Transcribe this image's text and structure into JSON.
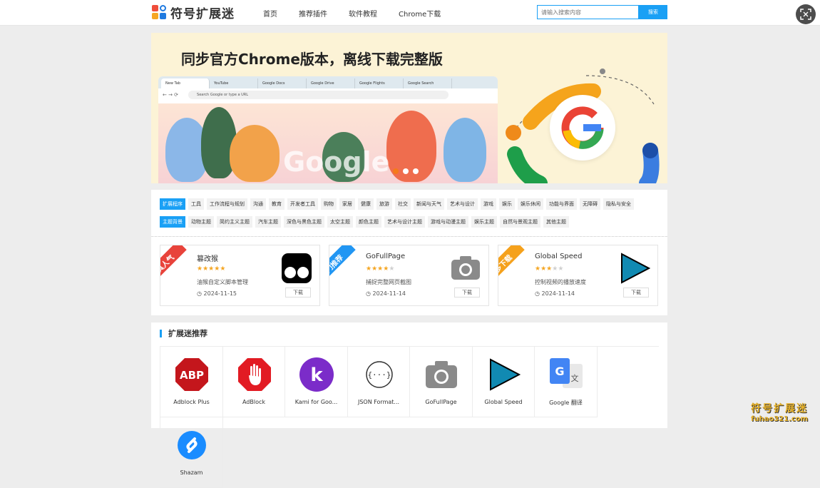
{
  "site": {
    "logo_text": "符号扩展迷"
  },
  "nav": [
    "首页",
    "推荐插件",
    "软件教程",
    "Chrome下载"
  ],
  "search": {
    "placeholder": "请输入搜索内容",
    "button": "搜索"
  },
  "banner": {
    "title": "同步官方Chrome版本，离线下载完整版",
    "tabs": [
      "New Tab",
      "YouTube",
      "Google Docs",
      "Google Drive",
      "Google Flights",
      "Google Search"
    ],
    "url_placeholder": "Search Google or type a URL",
    "doodle_word": "Google"
  },
  "categories": {
    "ext_head": "扩展程序",
    "ext": [
      "工具",
      "工作流程与规划",
      "沟通",
      "教育",
      "开发者工具",
      "购物",
      "家居",
      "健康",
      "旅游",
      "社交",
      "新闻与天气",
      "艺术与设计",
      "游戏",
      "娱乐",
      "娱乐休闲",
      "功能与界面",
      "无障碍",
      "隐私与安全"
    ],
    "theme_head": "主题背景",
    "theme": [
      "动物主题",
      "简约主义主题",
      "汽车主题",
      "深色与黑色主题",
      "太空主题",
      "颜色主题",
      "艺术与设计主题",
      "游戏与动漫主题",
      "娱乐主题",
      "自然与景观主题",
      "其他主题"
    ]
  },
  "featured": [
    {
      "ribbon": "最具人气",
      "ribbon_color": "#e8433b",
      "name": "篡改猴",
      "rating": 5,
      "desc": "油猴自定义脚本管理",
      "date": "2024-11-15",
      "download": "下载"
    },
    {
      "ribbon": "热门推荐",
      "ribbon_color": "#2196f3",
      "name": "GoFullPage",
      "rating": 4,
      "desc": "捕捉完整网页截图",
      "date": "2024-11-14",
      "download": "下载"
    },
    {
      "ribbon": "最多下载",
      "ribbon_color": "#f5a11c",
      "name": "Global Speed",
      "rating": 3,
      "desc": "控制视频的播放速度",
      "date": "2024-11-14",
      "download": "下载"
    }
  ],
  "recommend": {
    "title": "扩展迷推荐",
    "items": [
      "Adblock Plus",
      "AdBlock",
      "Kami for Goo...",
      "JSON Format...",
      "GoFullPage",
      "Global Speed",
      "Google 翻译",
      "Shazam"
    ]
  },
  "watermark": {
    "line1": "符号扩展迷",
    "line2": "fuhao321.com"
  }
}
